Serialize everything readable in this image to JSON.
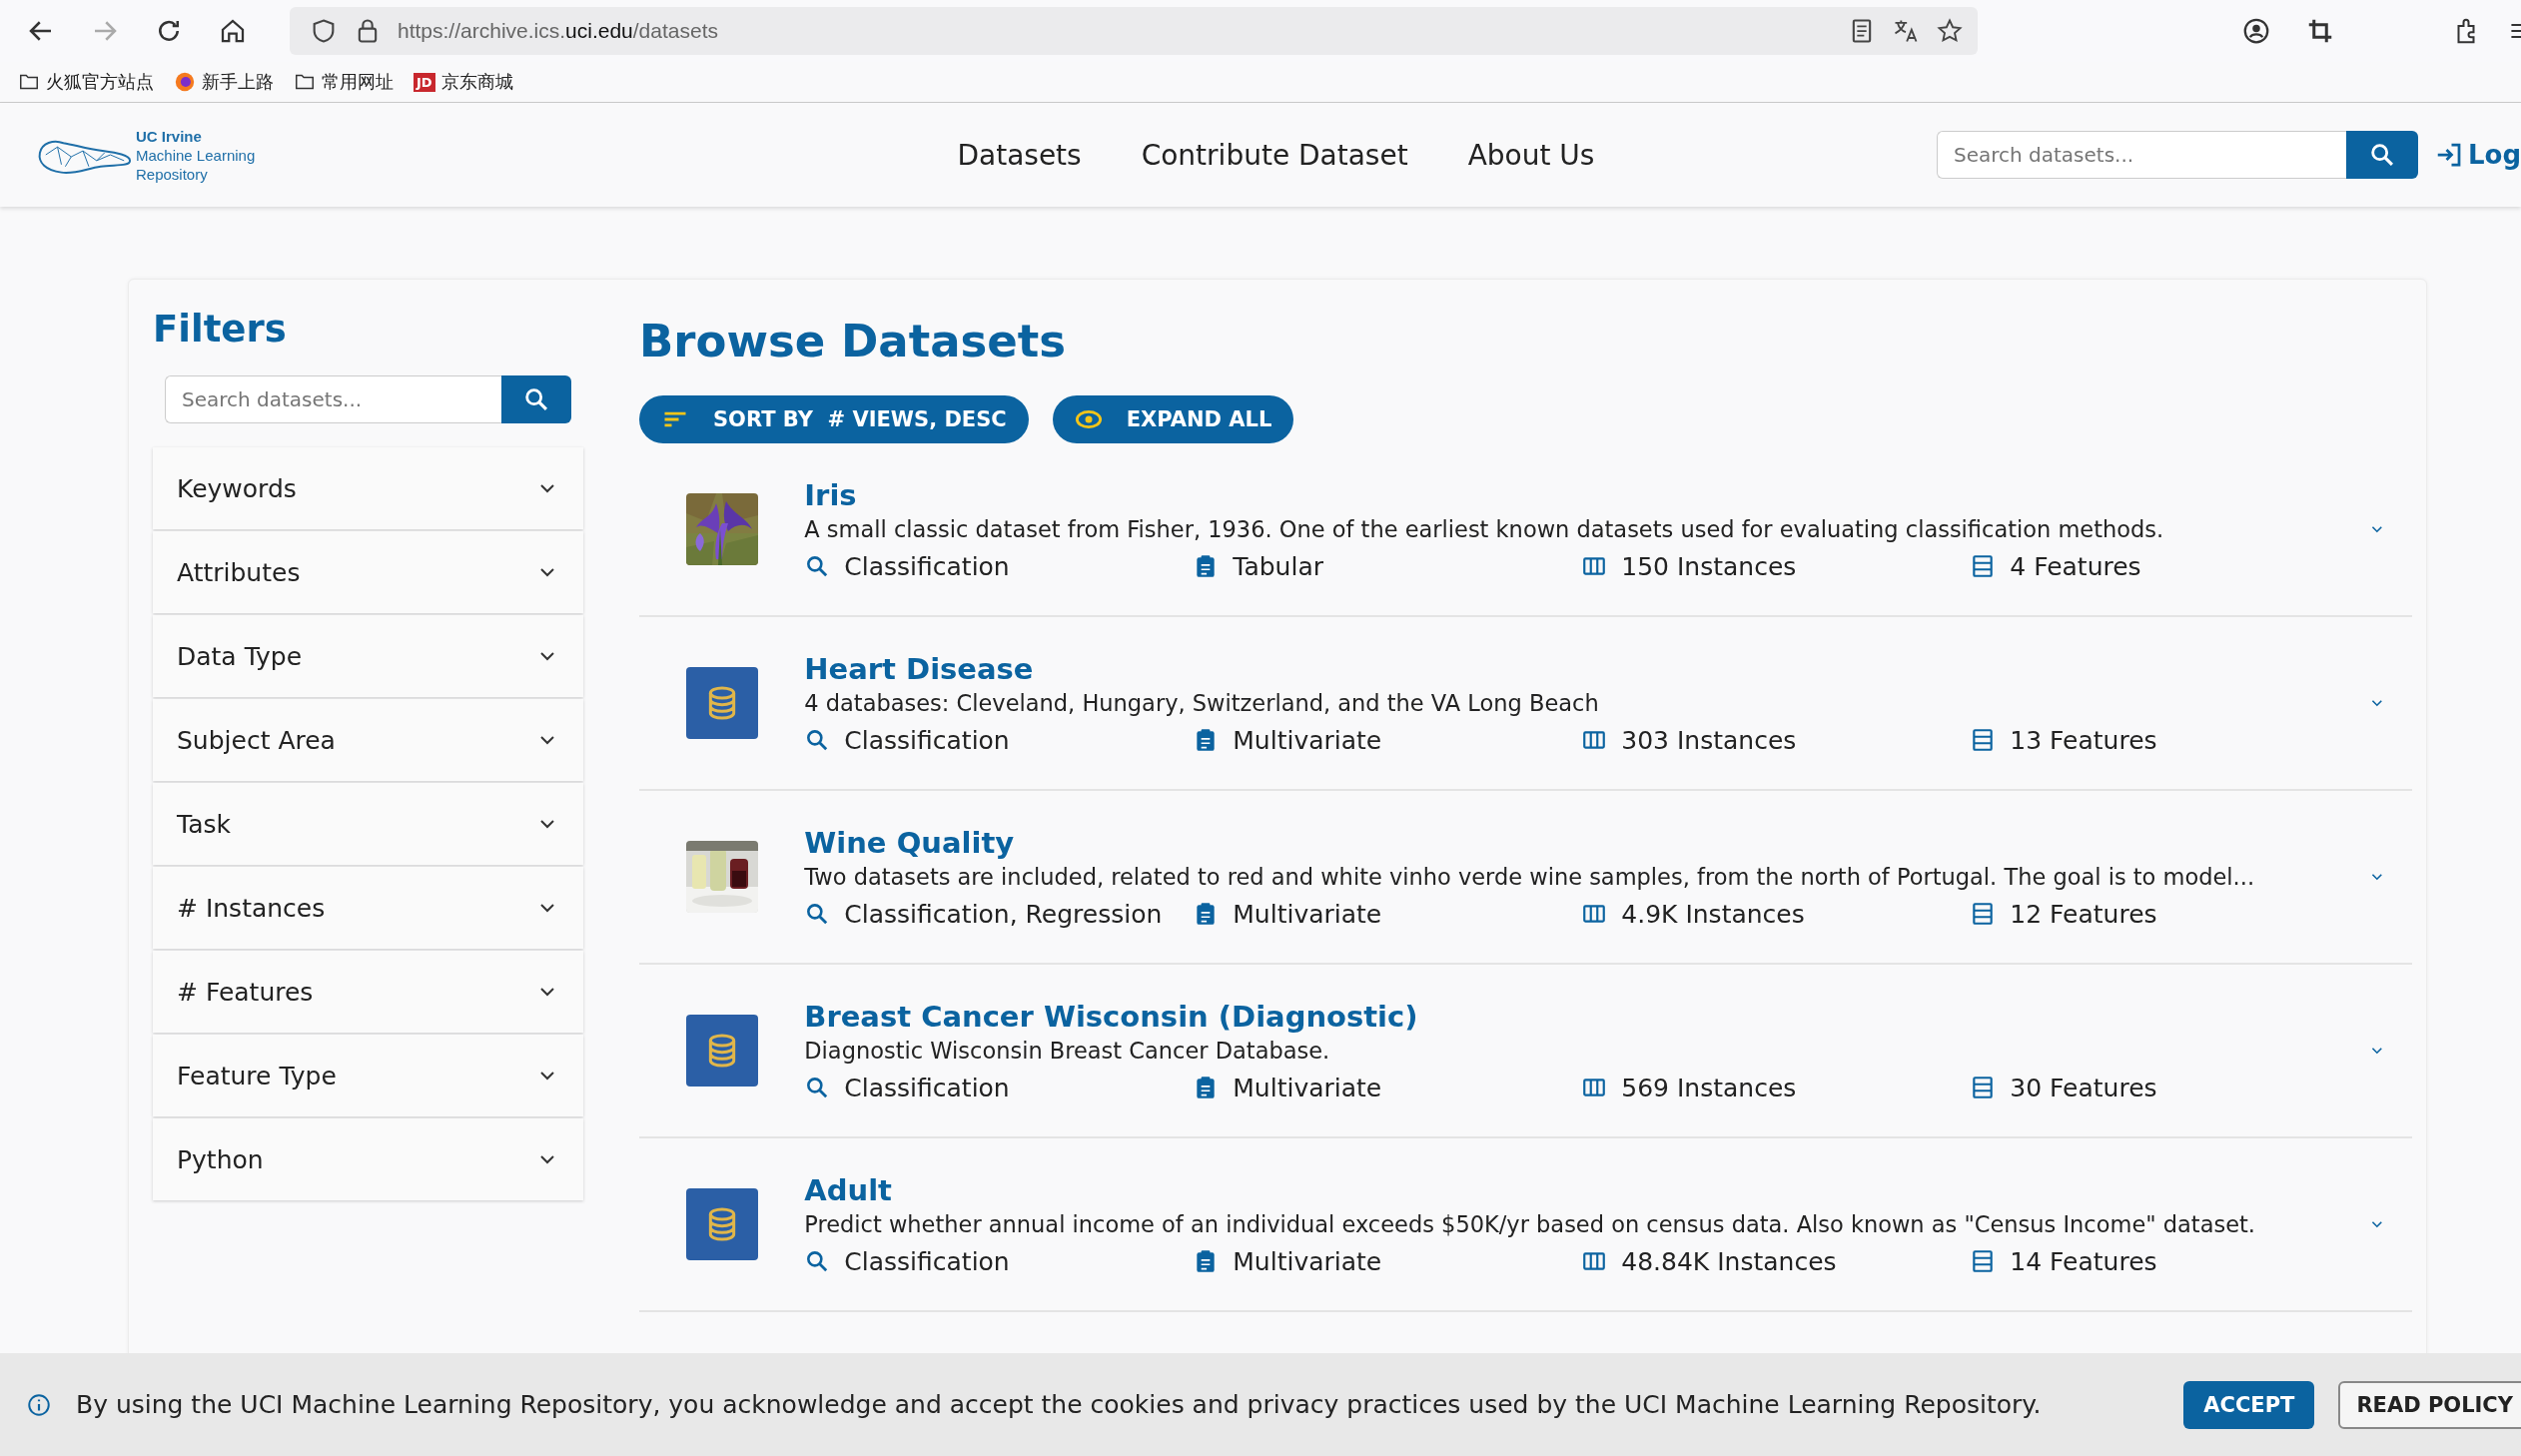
{
  "browser": {
    "url_host_prefix": "https://archive.ics.",
    "url_host_main": "uci.edu",
    "url_path": "/datasets",
    "bookmarks": [
      {
        "kind": "folder",
        "label": "火狐官方站点"
      },
      {
        "kind": "fox",
        "label": "新手上路"
      },
      {
        "kind": "folder",
        "label": "常用网址"
      },
      {
        "kind": "badge",
        "icon_text": "JD",
        "label": "京东商城"
      }
    ]
  },
  "header": {
    "logo_lines": [
      "UC Irvine",
      "Machine Learning",
      "Repository"
    ],
    "nav": [
      "Datasets",
      "Contribute Dataset",
      "About Us"
    ],
    "search": {
      "placeholder": "Search datasets..."
    },
    "login": "Log"
  },
  "filters": {
    "title": "Filters",
    "search": {
      "placeholder": "Search datasets..."
    },
    "items": [
      {
        "label": "Keywords",
        "expanded": false
      },
      {
        "label": "Attributes",
        "expanded": false
      },
      {
        "label": "Data Type",
        "expanded": false
      },
      {
        "label": "Subject Area",
        "expanded": false
      },
      {
        "label": "Task",
        "expanded": false
      },
      {
        "label": "# Instances",
        "expanded": false
      },
      {
        "label": "# Features",
        "expanded": false
      },
      {
        "label": "Feature Type",
        "expanded": false
      },
      {
        "label": "Python",
        "expanded": false
      }
    ]
  },
  "browse": {
    "title": "Browse Datasets",
    "sort_button": "SORT BY  # VIEWS, DESC",
    "expand_button": "EXPAND ALL",
    "datasets": [
      {
        "title": "Iris",
        "description": "A small classic dataset from Fisher, 1936. One of the earliest known datasets used for evaluating classification methods.",
        "task": "Classification",
        "data_type": "Tabular",
        "instances": "150 Instances",
        "features": "4 Features",
        "expanded": false
      },
      {
        "kind": "database",
        "title": "Heart Disease",
        "description": "4 databases: Cleveland, Hungary, Switzerland, and the VA Long Beach",
        "task": "Classification",
        "data_type": "Multivariate",
        "instances": "303 Instances",
        "features": "13 Features",
        "expanded": false
      },
      {
        "title": "Wine Quality",
        "description": "Two datasets are included, related to red and white vinho verde wine samples, from the north of Portugal. The goal is to model...",
        "task": "Classification, Regression",
        "data_type": "Multivariate",
        "instances": "4.9K Instances",
        "features": "12 Features",
        "expanded": false
      },
      {
        "kind": "database",
        "title": "Breast Cancer Wisconsin (Diagnostic)",
        "description": "Diagnostic Wisconsin Breast Cancer Database.",
        "task": "Classification",
        "data_type": "Multivariate",
        "instances": "569 Instances",
        "features": "30 Features",
        "expanded": false
      },
      {
        "kind": "database",
        "title": "Adult",
        "description": "Predict whether annual income of an individual exceeds $50K/yr based on census data. Also known as \"Census Income\" dataset.",
        "task": "Classification",
        "data_type": "Multivariate",
        "instances": "48.84K Instances",
        "features": "14 Features",
        "expanded": false
      }
    ]
  },
  "cookie_banner": {
    "text": "By using the UCI Machine Learning Repository, you acknowledge and accept the cookies and privacy practices used by the UCI Machine Learning Repository.",
    "accept": "ACCEPT",
    "read_policy": "READ POLICY"
  }
}
